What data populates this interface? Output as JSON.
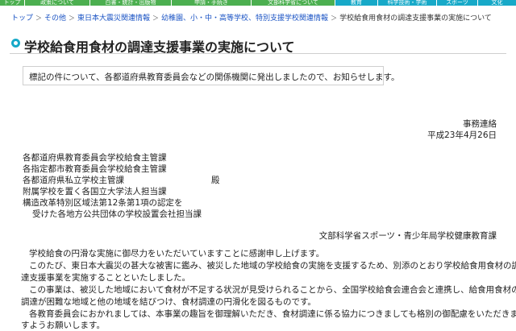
{
  "colors": {
    "nav_green": "#4caf50",
    "nav_cyan": "#17a9c8",
    "link_blue": "#1a53c4",
    "title_icon": "#17a9c8"
  },
  "topnav": {
    "items": [
      "トップ",
      "政策について",
      "白書・統計・出版物",
      "申請・手続き",
      "文部科学省について",
      "教育",
      "科学技術・学術",
      "スポーツ",
      "文化"
    ]
  },
  "breadcrumb": {
    "items": [
      "トップ",
      "その他",
      "東日本大震災関連情報",
      "幼稚園、小・中・高等学校、特別支援学校関連情報",
      "学校給食用食材の調達支援事業の実施について"
    ],
    "separator": "＞"
  },
  "page": {
    "title": "学校給食用食材の調達支援事業の実施について",
    "notice": "標記の件について、各都道府県教育委員会などの関係機関に発出しましたので、お知らせします。"
  },
  "letter": {
    "type": "事務連絡",
    "date": "平成23年4月26日",
    "recipients": [
      "各都道府県教育委員会学校給食主管課",
      "各指定都市教育委員会学校給食主管課",
      "各都道府県私立学校主管課",
      "附属学校を置く各国立大学法人担当課",
      "構造改革特別区域法第12条第1項の認定を",
      "受けた各地方公共団体の学校設置会社担当課"
    ],
    "honorific": "殿",
    "sender": "文部科学省スポーツ・青少年局学校健康教育課",
    "body": [
      "学校給食の円滑な実施に御尽力をいただいていますことに感謝申し上げます。",
      "このたび、東日本大震災の甚大な被害に鑑み、被災した地域の学校給食の実施を支援するため、別添のとおり学校給食用食材の調",
      "達支援事業を実施することといたしました。",
      "この事業は、被災した地域において食材が不足する状況が見受けられることから、全国学校給食会連合会と連携し、給食用食材の",
      "調達が困難な地域と他の地域を結びつけ、食材調達の円滑化を図るものです。",
      "各教育委員会におかれましては、本事業の趣旨を御理解いただき、食材調達に係る協力につきましても格別の御配慮をいただきま",
      "すようお願いします。"
    ]
  }
}
